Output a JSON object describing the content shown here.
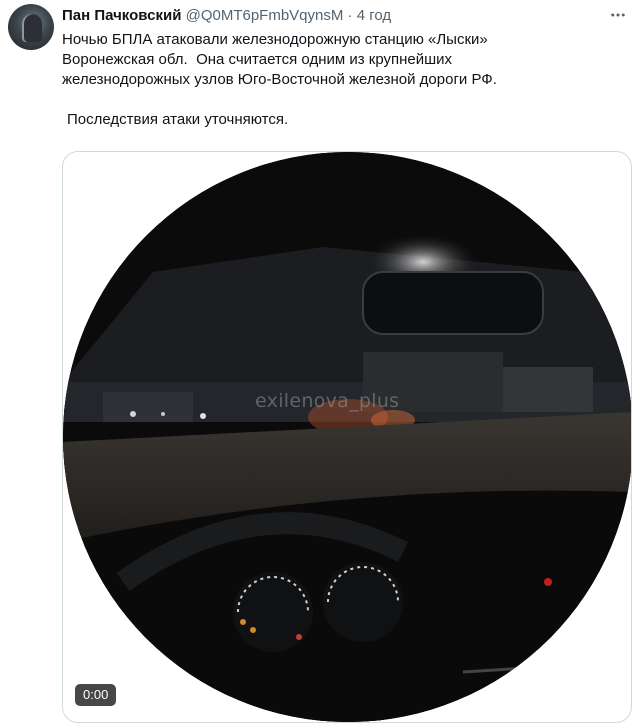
{
  "tweet": {
    "author_name": "Пан Пачковский",
    "author_handle": "@Q0MT6pFmbVqynsM",
    "separator": "·",
    "time": "4 год",
    "paragraph_1": "Ночью БПЛА атаковали железнодорожную станцию «Лыски»\nВоронежская обл.  Она считается одним из крупнейших\nжелезнодорожных узлов Юго-Восточной железной дороги РФ.",
    "paragraph_2": "Последствия атаки уточняются."
  },
  "media": {
    "watermark": "exilenova_plus",
    "timestamp": "0:00"
  },
  "icons": {
    "avatar": "avatar",
    "more": "more-icon"
  },
  "colors": {
    "primary_text": "#0f1419",
    "secondary_text": "#536471",
    "border": "#cfd9de"
  }
}
